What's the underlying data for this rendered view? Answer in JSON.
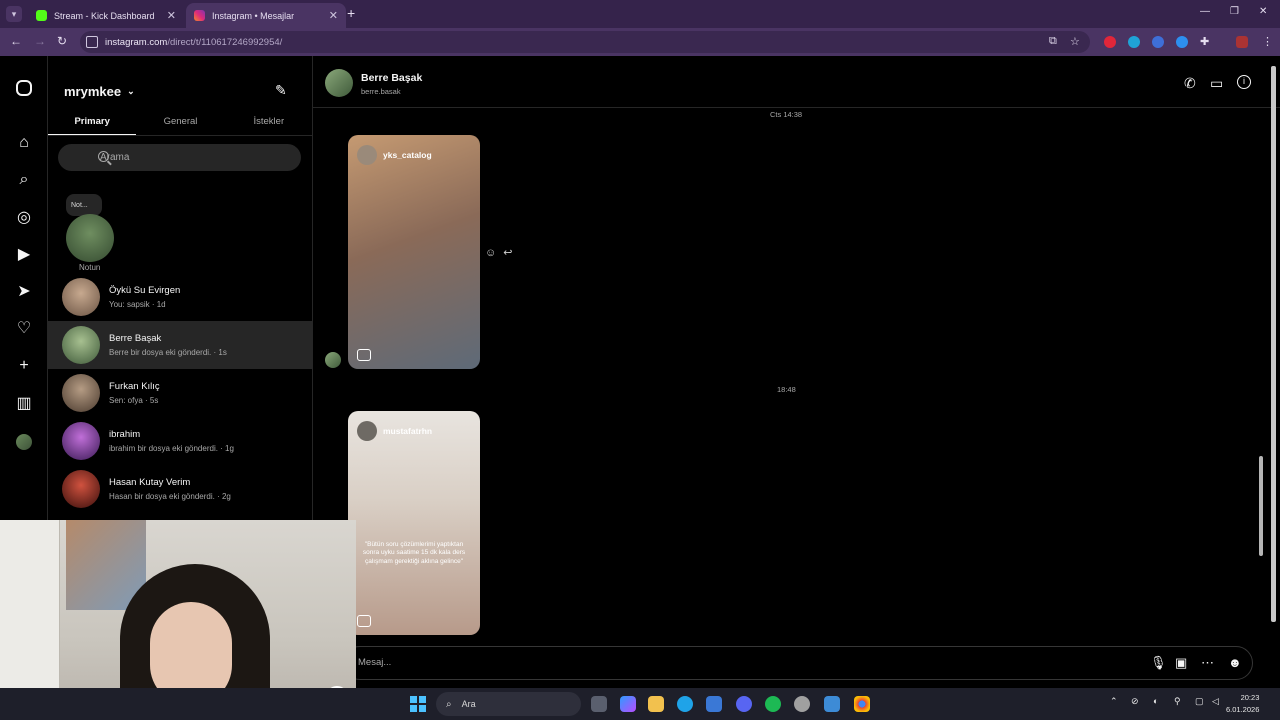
{
  "browser": {
    "tabs": [
      {
        "title": "Stream - Kick Dashboard",
        "active": false,
        "favicon_color": "#53fc18"
      },
      {
        "title": "Instagram • Mesajlar",
        "active": true,
        "favicon_color": "#e1306c"
      }
    ],
    "new_tab_label": "+",
    "url_host": "instagram.com",
    "url_path": "/direct/t/110617246992954/"
  },
  "sidebar": {
    "username": "mrymkee",
    "tabs": [
      "Primary",
      "General",
      "İstekler"
    ],
    "selected_tab": "Primary",
    "search_placeholder": "Arama",
    "note": {
      "bubble_text": "Not...",
      "label": "Notun"
    },
    "threads": [
      {
        "name": "Öykü Su Evirgen",
        "preview": "You: sapsik · 1d",
        "selected": false,
        "avatar_color": "#9b8370"
      },
      {
        "name": "Berre Başak",
        "preview": "Berre bir dosya eki gönderdi. · 1s",
        "selected": true,
        "avatar_color": "#6f8e60"
      },
      {
        "name": "Furkan Kılıç",
        "preview": "Sen: ofya · 5s",
        "selected": false,
        "avatar_color": "#7a6a5a"
      },
      {
        "name": "ibrahim",
        "preview": "ibrahim bir dosya eki gönderdi. · 1g",
        "selected": false,
        "avatar_color": "#7b3fa0"
      },
      {
        "name": "Hasan Kutay Verim",
        "preview": "Hasan bir dosya eki gönderdi. · 2g",
        "selected": false,
        "avatar_color": "#8a2a22"
      }
    ]
  },
  "chat": {
    "contact_name": "Berre Başak",
    "contact_handle": "berre.basak",
    "timestamps": [
      "Cts 14:38",
      "18:48"
    ],
    "reels": [
      {
        "owner": "yks_catalog",
        "overlay": "",
        "bg_from": "#c59a72",
        "bg_to": "#5e6a78"
      },
      {
        "owner": "mustafatrhn",
        "overlay": "\"Bütün soru çözümlerimi yaptıktan sonra uyku saatime 15 dk kala ders çalışmam gerektiği aklına gelince\"",
        "bg_from": "#e8e4df",
        "bg_to": "#b79a8a"
      }
    ],
    "composer_placeholder": "Mesaj..."
  },
  "taskbar": {
    "search_label": "Ara",
    "time": "20:23",
    "date": "6.01.2026"
  },
  "colors": {
    "accent_instagram": "#e1306c",
    "browser_frame": "#35234b",
    "selected_thread_bg": "#262626"
  }
}
